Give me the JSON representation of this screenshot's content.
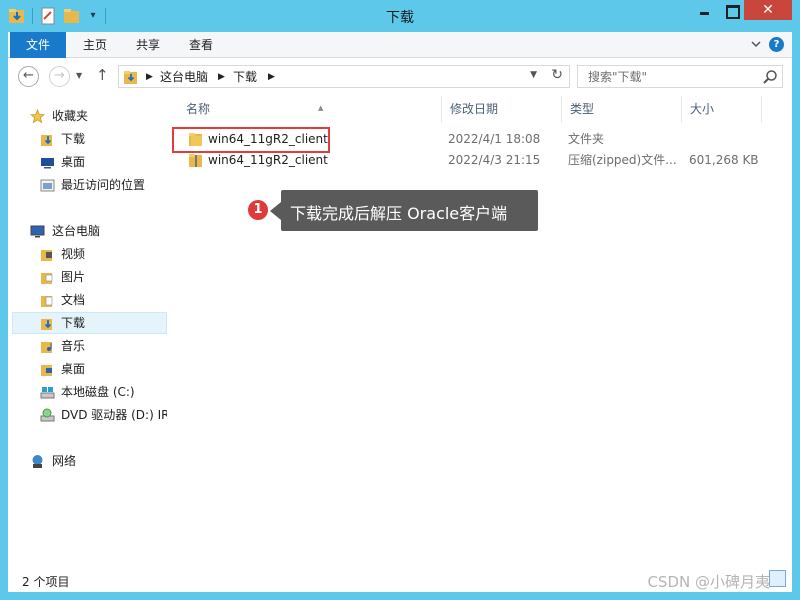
{
  "window": {
    "title": "下载"
  },
  "ribbon": {
    "tabs": [
      {
        "label": "文件"
      },
      {
        "label": "主页"
      },
      {
        "label": "共享"
      },
      {
        "label": "查看"
      }
    ]
  },
  "address": {
    "crumbs": [
      "这台电脑",
      "下载"
    ]
  },
  "search": {
    "placeholder": "搜索\"下载\""
  },
  "sidebar": {
    "items": [
      {
        "label": "收藏夹",
        "icon": "star-icon"
      },
      {
        "label": "下载",
        "icon": "download-folder-icon"
      },
      {
        "label": "桌面",
        "icon": "desktop-icon"
      },
      {
        "label": "最近访问的位置",
        "icon": "recent-places-icon"
      },
      {
        "label": "这台电脑",
        "icon": "computer-icon"
      },
      {
        "label": "视频",
        "icon": "video-folder-icon"
      },
      {
        "label": "图片",
        "icon": "pictures-folder-icon"
      },
      {
        "label": "文档",
        "icon": "documents-folder-icon"
      },
      {
        "label": "下载",
        "icon": "download-folder-icon"
      },
      {
        "label": "音乐",
        "icon": "music-folder-icon"
      },
      {
        "label": "桌面",
        "icon": "desktop-icon"
      },
      {
        "label": "本地磁盘 (C:)",
        "icon": "drive-icon"
      },
      {
        "label": "DVD 驱动器 (D:) IR",
        "icon": "dvd-drive-icon"
      },
      {
        "label": "网络",
        "icon": "network-icon"
      }
    ]
  },
  "columns": {
    "name": "名称",
    "modified": "修改日期",
    "type": "类型",
    "size": "大小"
  },
  "files": [
    {
      "name": "win64_11gR2_client",
      "modified": "2022/4/1 18:08",
      "type": "文件夹",
      "size": ""
    },
    {
      "name": "win64_11gR2_client",
      "modified": "2022/4/3 21:15",
      "type": "压缩(zipped)文件...",
      "size": "601,268 KB"
    }
  ],
  "annotation": {
    "number": "1",
    "text": "下载完成后解压 Oracle客户端"
  },
  "status": {
    "count": "2 个项目"
  },
  "watermark": "CSDN @小碑月夷",
  "colors": {
    "titlebar": "#5ec8ea",
    "file_tab": "#1979ca",
    "close": "#c9463d",
    "annotation_red": "#e13d3d"
  }
}
